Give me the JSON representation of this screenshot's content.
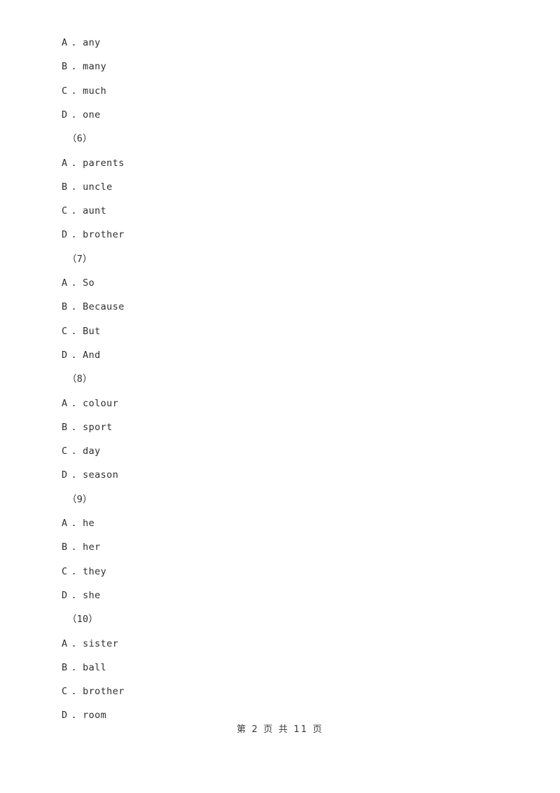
{
  "document": {
    "page_background": "#ffffff",
    "text_color": "#2f2f2f"
  },
  "blocks": [
    {
      "type": "options",
      "options": [
        {
          "letter": "A",
          "separator": ".",
          "text": "any"
        },
        {
          "letter": "B",
          "separator": ".",
          "text": "many"
        },
        {
          "letter": "C",
          "separator": ".",
          "text": "much"
        },
        {
          "letter": "D",
          "separator": ".",
          "text": "one"
        }
      ]
    },
    {
      "type": "question",
      "number": "（6）",
      "options": [
        {
          "letter": "A",
          "separator": ".",
          "text": "parents"
        },
        {
          "letter": "B",
          "separator": ".",
          "text": "uncle"
        },
        {
          "letter": "C",
          "separator": ".",
          "text": "aunt"
        },
        {
          "letter": "D",
          "separator": ".",
          "text": "brother"
        }
      ]
    },
    {
      "type": "question",
      "number": "（7）",
      "options": [
        {
          "letter": "A",
          "separator": ".",
          "text": "So"
        },
        {
          "letter": "B",
          "separator": ".",
          "text": "Because"
        },
        {
          "letter": "C",
          "separator": ".",
          "text": "But"
        },
        {
          "letter": "D",
          "separator": ".",
          "text": "And"
        }
      ]
    },
    {
      "type": "question",
      "number": "（8）",
      "options": [
        {
          "letter": "A",
          "separator": ".",
          "text": "colour"
        },
        {
          "letter": "B",
          "separator": ".",
          "text": "sport"
        },
        {
          "letter": "C",
          "separator": ".",
          "text": "day"
        },
        {
          "letter": "D",
          "separator": ".",
          "text": "season"
        }
      ]
    },
    {
      "type": "question",
      "number": "（9）",
      "options": [
        {
          "letter": "A",
          "separator": ".",
          "text": "he"
        },
        {
          "letter": "B",
          "separator": ".",
          "text": "her"
        },
        {
          "letter": "C",
          "separator": ".",
          "text": "they"
        },
        {
          "letter": "D",
          "separator": ".",
          "text": "she"
        }
      ]
    },
    {
      "type": "question",
      "number": "（10）",
      "options": [
        {
          "letter": "A",
          "separator": ".",
          "text": "sister"
        },
        {
          "letter": "B",
          "separator": ".",
          "text": "ball"
        },
        {
          "letter": "C",
          "separator": ".",
          "text": "brother"
        },
        {
          "letter": "D",
          "separator": ".",
          "text": "room"
        }
      ]
    }
  ],
  "footer": {
    "text": "第 2 页 共 11 页",
    "page_number": "2",
    "total_pages": "11"
  }
}
